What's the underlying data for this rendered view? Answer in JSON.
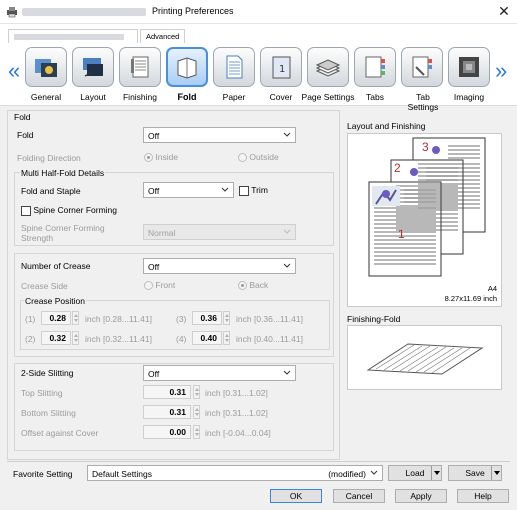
{
  "window": {
    "title": "Printing Preferences",
    "close_glyph": "✕"
  },
  "tabs": {
    "advanced": "Advanced"
  },
  "nav": {
    "left_arrow": "«",
    "right_arrow": "»"
  },
  "icons": [
    {
      "label": "General",
      "icon": "general-icon"
    },
    {
      "label": "Layout",
      "icon": "layout-icon"
    },
    {
      "label": "Finishing",
      "icon": "finishing-icon"
    },
    {
      "label": "Fold",
      "icon": "fold-icon",
      "selected": true
    },
    {
      "label": "Paper",
      "icon": "paper-icon"
    },
    {
      "label": "Cover",
      "icon": "cover-icon"
    },
    {
      "label": "Page Settings",
      "icon": "page-settings-icon"
    },
    {
      "label": "Tabs",
      "icon": "tabs-icon"
    },
    {
      "label": "Tab Settings",
      "icon": "tab-settings-icon"
    },
    {
      "label": "Imaging",
      "icon": "imaging-icon"
    }
  ],
  "fold": {
    "group_title": "Fold",
    "fold_label": "Fold",
    "fold_value": "Off",
    "direction_label": "Folding Direction",
    "inside": "Inside",
    "outside": "Outside",
    "multi_title": "Multi Half-Fold Details",
    "fold_staple_label": "Fold and Staple",
    "fold_staple_value": "Off",
    "trim": "Trim",
    "spine_corner": "Spine Corner Forming",
    "spine_strength_label": "Spine Corner Forming Strength",
    "spine_strength_value": "Normal",
    "crease_count_label": "Number of Crease",
    "crease_count_value": "Off",
    "crease_side_label": "Crease Side",
    "front": "Front",
    "back": "Back",
    "crease_pos_title": "Crease Position",
    "positions": [
      {
        "n": "(1)",
        "value": "0.28",
        "range": "inch [0.28...11.41]"
      },
      {
        "n": "(2)",
        "value": "0.32",
        "range": "inch [0.32...11.41]"
      },
      {
        "n": "(3)",
        "value": "0.36",
        "range": "inch [0.36...11.41]"
      },
      {
        "n": "(4)",
        "value": "0.40",
        "range": "inch [0.40...11.41]"
      }
    ],
    "slitting_label": "2-Side Slitting",
    "slitting_value": "Off",
    "top_slit_label": "Top Slitting",
    "top_slit_value": "0.31",
    "top_slit_range": "inch [0.31...1.02]",
    "bottom_slit_label": "Bottom Slitting",
    "bottom_slit_value": "0.31",
    "bottom_slit_range": "inch [0.31...1.02]",
    "offset_label": "Offset against Cover",
    "offset_value": "0.00",
    "offset_range": "inch [-0.04...0.04]"
  },
  "preview": {
    "layout_title": "Layout and Finishing",
    "pages": [
      "1",
      "2",
      "3"
    ],
    "paper": "A4",
    "paper_size": "8.27x11.69 inch",
    "finishing_title": "Finishing-Fold"
  },
  "footer": {
    "favorite_label": "Favorite Setting",
    "favorite_value": "Default Settings",
    "modified": "(modified)",
    "load": "Load",
    "save": "Save",
    "ok": "OK",
    "cancel": "Cancel",
    "apply": "Apply",
    "help": "Help"
  }
}
